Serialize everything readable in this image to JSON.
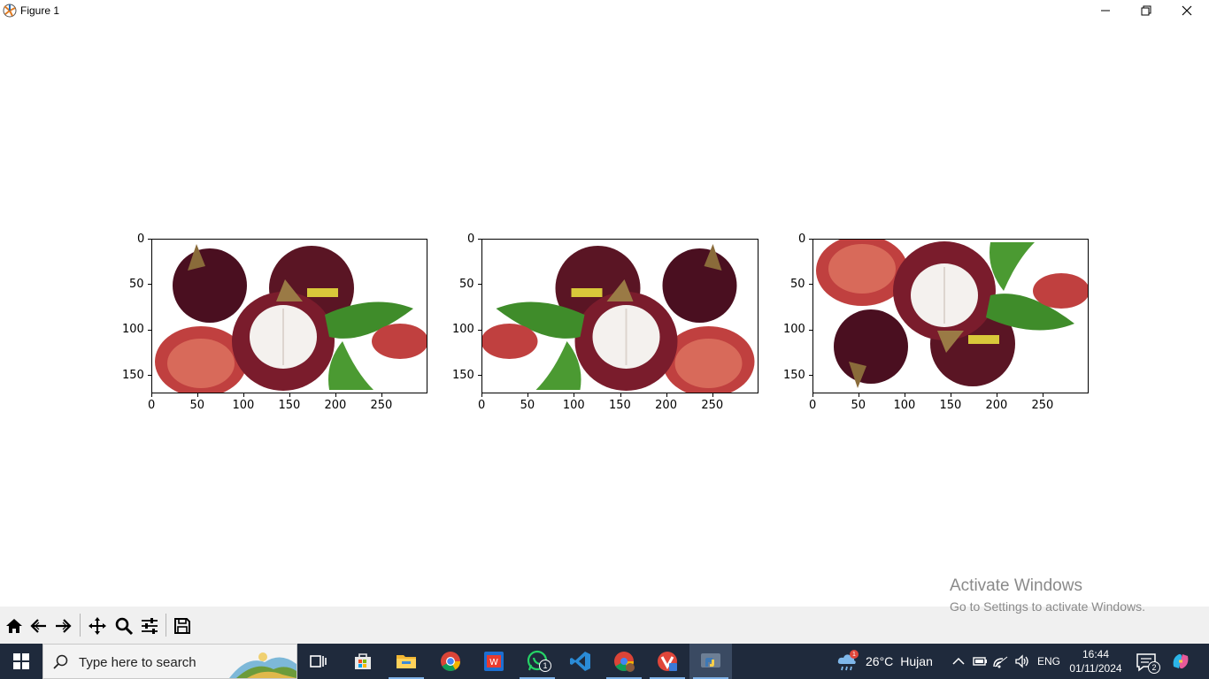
{
  "window": {
    "title": "Figure 1",
    "icons": {
      "app": "matplotlib-icon",
      "minimize": "minimize-icon",
      "maximize": "restore-icon",
      "close": "close-icon"
    }
  },
  "figure": {
    "subplots": [
      {
        "name": "original",
        "content": "mangosteen-photo",
        "orientation": "normal",
        "x_ticks": [
          "0",
          "50",
          "100",
          "150",
          "200",
          "250"
        ],
        "y_ticks": [
          "0",
          "50",
          "100",
          "150"
        ]
      },
      {
        "name": "flipped-horizontal",
        "content": "mangosteen-photo",
        "orientation": "mirrored",
        "x_ticks": [
          "0",
          "50",
          "100",
          "150",
          "200",
          "250"
        ],
        "y_ticks": [
          "0",
          "50",
          "100",
          "150"
        ]
      },
      {
        "name": "flipped-vertical",
        "content": "mangosteen-photo",
        "orientation": "upside-down",
        "x_ticks": [
          "0",
          "50",
          "100",
          "150",
          "200",
          "250"
        ],
        "y_ticks": [
          "0",
          "50",
          "100",
          "150"
        ]
      }
    ],
    "x_range": [
      0,
      300
    ],
    "y_range": [
      0,
      170
    ],
    "colors": {
      "fruit_dark": "#4a0f20",
      "fruit_mid": "#7a1c2c",
      "flesh_white": "#f4f1ee",
      "leaf_green": "#3f8c2a",
      "rind_red": "#c0403f"
    }
  },
  "toolbar": {
    "buttons": [
      "home-icon",
      "back-icon",
      "forward-icon",
      "pan-icon",
      "zoom-icon",
      "configure-subplots-icon",
      "save-icon"
    ]
  },
  "watermark": {
    "title": "Activate Windows",
    "subtitle": "Go to Settings to activate Windows."
  },
  "taskbar": {
    "search_placeholder": "Type here to search",
    "apps": [
      "task-view-icon",
      "microsoft-store-icon",
      "file-explorer-icon",
      "chrome-icon",
      "wps-office-icon",
      "whatsapp-icon",
      "vscode-icon",
      "chrome-profile-icon",
      "vivaldi-icon",
      "python-icon"
    ],
    "whatsapp_badge": "1",
    "weather": {
      "temperature": "26°C",
      "condition": "Hujan",
      "alert": "1"
    },
    "language": "ENG",
    "time": "16:44",
    "date": "01/11/2024",
    "notification_count": "2"
  }
}
